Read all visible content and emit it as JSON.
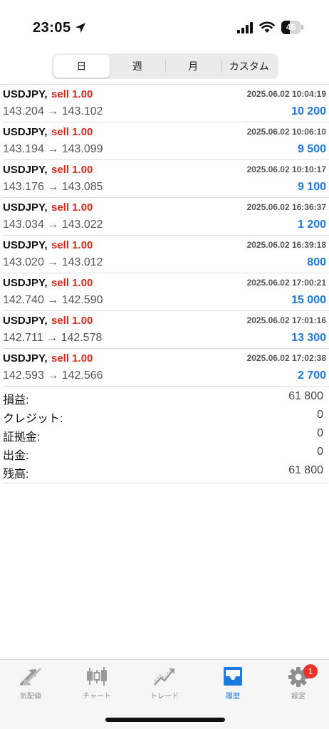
{
  "status_bar": {
    "time": "23:05",
    "battery_level": "45",
    "battery_fraction": 0.45
  },
  "segments": [
    {
      "label": "日",
      "active": true
    },
    {
      "label": "週",
      "active": false
    },
    {
      "label": "月",
      "active": false
    },
    {
      "label": "カスタム",
      "active": false
    }
  ],
  "trades": [
    {
      "symbol": "USDJPY,",
      "side": "sell 1.00",
      "time": "2025.06.02 10:04:19",
      "prices": "143.204 → 143.102",
      "profit": "10 200"
    },
    {
      "symbol": "USDJPY,",
      "side": "sell 1.00",
      "time": "2025.06.02 10:06:10",
      "prices": "143.194 → 143.099",
      "profit": "9 500"
    },
    {
      "symbol": "USDJPY,",
      "side": "sell 1.00",
      "time": "2025.06.02 10:10:17",
      "prices": "143.176 → 143.085",
      "profit": "9 100"
    },
    {
      "symbol": "USDJPY,",
      "side": "sell 1.00",
      "time": "2025.06.02 16:36:37",
      "prices": "143.034 → 143.022",
      "profit": "1 200"
    },
    {
      "symbol": "USDJPY,",
      "side": "sell 1.00",
      "time": "2025.06.02 16:39:18",
      "prices": "143.020 → 143.012",
      "profit": "800"
    },
    {
      "symbol": "USDJPY,",
      "side": "sell 1.00",
      "time": "2025.06.02 17:00:21",
      "prices": "142.740 → 142.590",
      "profit": "15 000"
    },
    {
      "symbol": "USDJPY,",
      "side": "sell 1.00",
      "time": "2025.06.02 17:01:16",
      "prices": "142.711 → 142.578",
      "profit": "13 300"
    },
    {
      "symbol": "USDJPY,",
      "side": "sell 1.00",
      "time": "2025.06.02 17:02:38",
      "prices": "142.593 → 142.566",
      "profit": "2 700"
    }
  ],
  "summary": [
    {
      "label": "損益:",
      "value": "61 800"
    },
    {
      "label": "クレジット:",
      "value": "0"
    },
    {
      "label": "証拠金:",
      "value": "0"
    },
    {
      "label": "出金:",
      "value": "0"
    },
    {
      "label": "残高:",
      "value": "61 800"
    }
  ],
  "tabbar": {
    "items": [
      {
        "label": "気配値",
        "icon": "quotes-arrows-icon",
        "active": false
      },
      {
        "label": "チャート",
        "icon": "candlestick-icon",
        "active": false
      },
      {
        "label": "トレード",
        "icon": "trade-line-icon",
        "active": false
      },
      {
        "label": "履歴",
        "icon": "inbox-tray-icon",
        "active": true
      },
      {
        "label": "設定",
        "icon": "gear-icon",
        "active": false
      }
    ],
    "settings_badge": "1"
  },
  "colors": {
    "sell": "#d8281b",
    "profit": "#1f7ae0",
    "active_tab": "#1a7be0",
    "inactive_tab": "#8a8a8a",
    "badge": "#e8332b"
  }
}
